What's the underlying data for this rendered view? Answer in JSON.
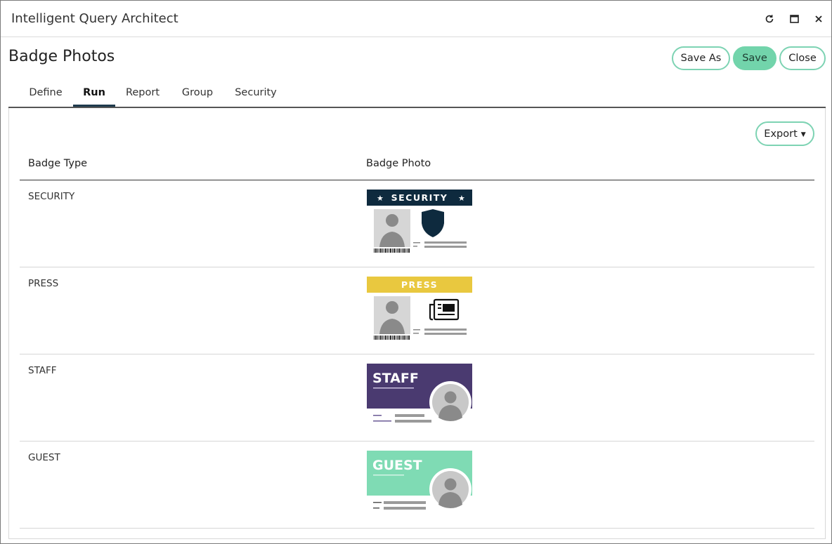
{
  "window": {
    "title": "Intelligent Query Architect",
    "controls": [
      "refresh-icon",
      "maximize-icon",
      "close-icon"
    ]
  },
  "header": {
    "title": "Badge Photos",
    "buttons": {
      "save_as": "Save As",
      "save": "Save",
      "close": "Close"
    }
  },
  "tabs": [
    {
      "label": "Define",
      "active": false
    },
    {
      "label": "Run",
      "active": true
    },
    {
      "label": "Report",
      "active": false
    },
    {
      "label": "Group",
      "active": false
    },
    {
      "label": "Security",
      "active": false
    }
  ],
  "toolbar": {
    "export_label": "Export"
  },
  "table": {
    "columns": [
      "Badge Type",
      "Badge Photo"
    ],
    "rows": [
      {
        "type": "SECURITY",
        "badge": {
          "style": "security",
          "header_text": "SECURITY",
          "color": "#0e2a3e",
          "icon": "shield-icon"
        }
      },
      {
        "type": "PRESS",
        "badge": {
          "style": "press",
          "header_text": "PRESS",
          "color": "#e9c83f",
          "icon": "newspaper-icon"
        }
      },
      {
        "type": "STAFF",
        "badge": {
          "style": "staff",
          "header_text": "STAFF",
          "color": "#4a3a70",
          "icon": "person-icon"
        }
      },
      {
        "type": "GUEST",
        "badge": {
          "style": "guest",
          "header_text": "GUEST",
          "color": "#7fdbb4",
          "icon": "person-icon"
        }
      }
    ]
  },
  "colors": {
    "accent": "#72d4ab",
    "tab_indicator": "#1e3a4c"
  }
}
